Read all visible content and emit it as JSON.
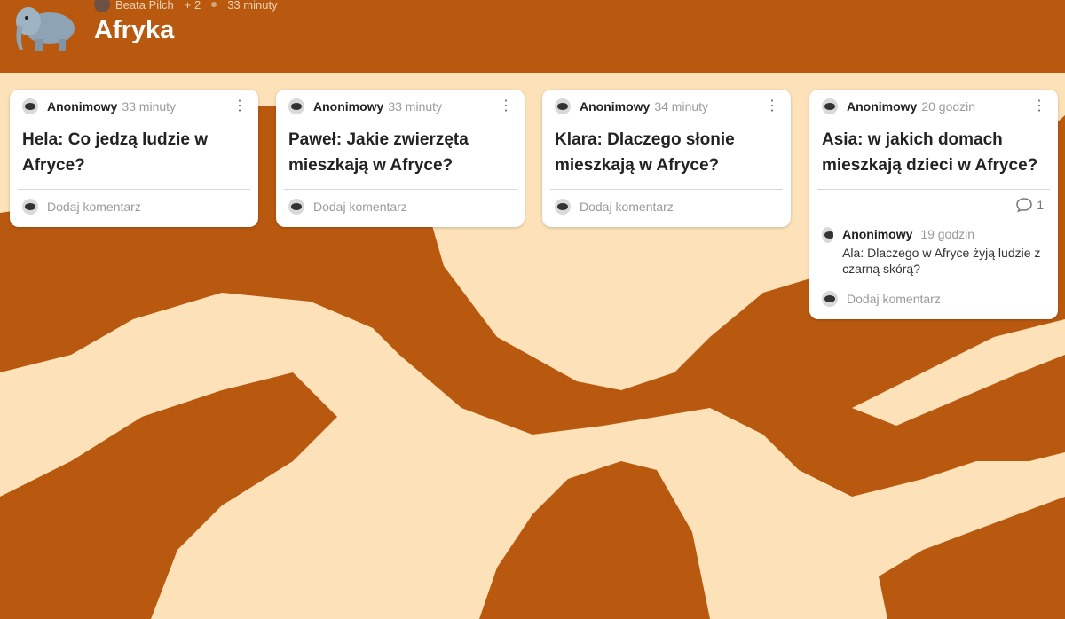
{
  "header": {
    "author": "Beata Pilch",
    "plus_count": "+ 2",
    "time": "33 minuty",
    "title": "Afryka"
  },
  "posts": [
    {
      "author": "Anonimowy",
      "time": "33 minuty",
      "title": "Hela: Co jedzą ludzie w Afryce?",
      "add_comment": "Dodaj komentarz"
    },
    {
      "author": "Anonimowy",
      "time": "33 minuty",
      "title": "Paweł: Jakie zwierzęta mieszkają w Afryce?",
      "add_comment": "Dodaj komentarz"
    },
    {
      "author": "Anonimowy",
      "time": "34 minuty",
      "title": "Klara: Dlaczego słonie mieszkają w Afryce?",
      "add_comment": "Dodaj komentarz"
    },
    {
      "author": "Anonimowy",
      "time": "20 godzin",
      "title": "Asia: w jakich domach mieszkają dzieci w Afryce?",
      "comment_count": "1",
      "comment": {
        "author": "Anonimowy",
        "time": "19 godzin",
        "text": "Ala: Dlaczego w Afryce żyją ludzie z czarną skórą?"
      },
      "add_comment": "Dodaj komentarz"
    }
  ],
  "colors": {
    "background": "#b9590f",
    "pattern": "#fde1b8"
  },
  "icons": {
    "menu": "more-vertical-icon",
    "comment": "speech-bubble-icon",
    "avatar": "anonymous-avatar-icon"
  }
}
